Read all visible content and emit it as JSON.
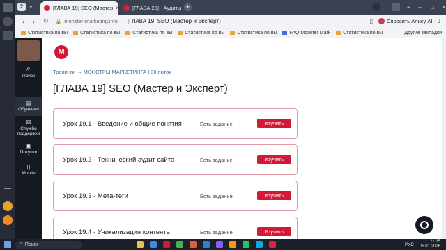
{
  "browser": {
    "tab_count_badge": "2",
    "tabs": [
      {
        "label": "[ГЛАВА 19] SEO (Мастер"
      },
      {
        "label": "[ГЛАВА 20] - Аудиты Я.Д"
      }
    ],
    "url": "monster-marketing.info",
    "page_title": "[ГЛАВА 19] SEO (Мастер и Эксперт)",
    "alice_label": "Спросить Алису AI",
    "bookmarks": [
      "Статистика по вы",
      "Статистика по вы",
      "Статистика по вы",
      "Статистика по вы",
      "Статистика по вы",
      "FAQ Monster Mark",
      "Статистика по вы"
    ],
    "other_bookmarks": "Другие закладки"
  },
  "sidebar": {
    "items": [
      {
        "label": "Поиск"
      },
      {
        "label": "Обучение"
      },
      {
        "label": "Служба поддержки"
      },
      {
        "label": "Покупки"
      },
      {
        "label": "Mobile"
      }
    ]
  },
  "page": {
    "breadcrumb": "Тренинги → МОНСТРЫ МАРКЕТИНГА | 30 поток",
    "title": "[ГЛАВА 19] SEO (Мастер и Эксперт)",
    "lessons": [
      {
        "title": "Урок 19.1 - Введение и общие понятия",
        "status": "Есть задание",
        "button": "Изучить"
      },
      {
        "title": "Урок 19.2 - Технический аудит сайта",
        "status": "Есть задание",
        "button": "Изучить"
      },
      {
        "title": "Урок 19.3 - Мета-теги",
        "status": "Есть задание",
        "button": "Изучить"
      },
      {
        "title": "Урок 19.4 - Уникализация контента",
        "status": "Есть задание",
        "button": "Изучить"
      }
    ]
  },
  "taskbar": {
    "search_label": "Поиск",
    "lang": "РУС",
    "time": "21:15",
    "date": "05.01.2026"
  },
  "colors": {
    "accent": "#d21936",
    "card_border": "#e39aa5",
    "sidebar_bg": "#151a22"
  }
}
